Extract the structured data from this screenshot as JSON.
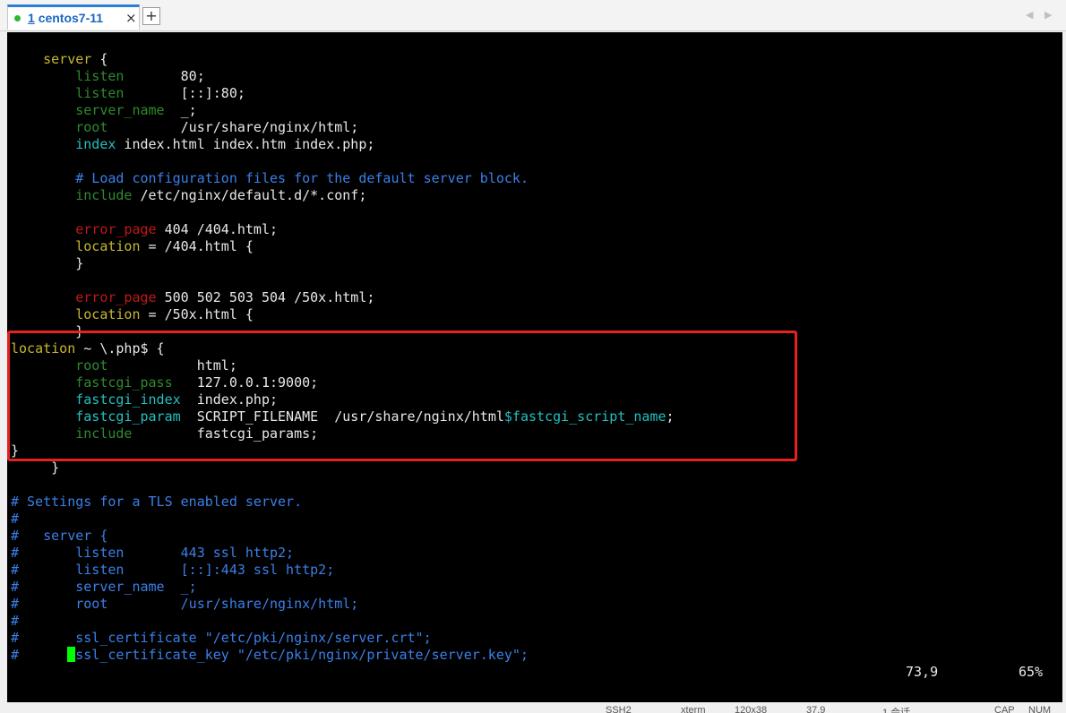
{
  "tabs": {
    "active": {
      "number": "1",
      "title": "centos7-11",
      "close": "×"
    },
    "add": "+",
    "prev": "◀",
    "next": "▶"
  },
  "terminal": {
    "lines": [
      [
        {
          "t": "    "
        },
        {
          "t": "server",
          "s": "ky"
        },
        {
          "t": " {"
        }
      ],
      [
        {
          "t": "        "
        },
        {
          "t": "listen",
          "s": "k"
        },
        {
          "t": "       80;"
        }
      ],
      [
        {
          "t": "        "
        },
        {
          "t": "listen",
          "s": "k"
        },
        {
          "t": "       [::]:80;"
        }
      ],
      [
        {
          "t": "        "
        },
        {
          "t": "server_name",
          "s": "k"
        },
        {
          "t": "  _;"
        }
      ],
      [
        {
          "t": "        "
        },
        {
          "t": "root",
          "s": "k"
        },
        {
          "t": "         /usr/share/nginx/html;"
        }
      ],
      [
        {
          "t": "        "
        },
        {
          "t": "index",
          "s": "kb"
        },
        {
          "t": " index.html index.htm index.php;"
        }
      ],
      [
        {
          "t": ""
        }
      ],
      [
        {
          "t": "        "
        },
        {
          "t": "# Load configuration files for the default server block.",
          "s": "c"
        }
      ],
      [
        {
          "t": "        "
        },
        {
          "t": "include",
          "s": "k"
        },
        {
          "t": " /etc/nginx/default.d/*.conf;"
        }
      ],
      [
        {
          "t": ""
        }
      ],
      [
        {
          "t": "        "
        },
        {
          "t": "error_page",
          "s": "kr"
        },
        {
          "t": " 404 /404.html;"
        }
      ],
      [
        {
          "t": "        "
        },
        {
          "t": "location",
          "s": "ky"
        },
        {
          "t": " = /404.html {"
        }
      ],
      [
        {
          "t": "        }"
        }
      ],
      [
        {
          "t": ""
        }
      ],
      [
        {
          "t": "        "
        },
        {
          "t": "error_page",
          "s": "kr"
        },
        {
          "t": " 500 502 503 504 /50x.html;"
        }
      ],
      [
        {
          "t": "        "
        },
        {
          "t": "location",
          "s": "ky"
        },
        {
          "t": " = /50x.html {"
        }
      ],
      [
        {
          "t": "        }"
        }
      ],
      [
        {
          "t": "location",
          "s": "ky"
        },
        {
          "t": " ~ \\.php$ {"
        }
      ],
      [
        {
          "t": "        "
        },
        {
          "t": "root",
          "s": "k"
        },
        {
          "t": "           html;"
        }
      ],
      [
        {
          "t": "        "
        },
        {
          "t": "fastcgi_pass",
          "s": "k"
        },
        {
          "t": "   127.0.0.1:9000;"
        }
      ],
      [
        {
          "t": "        "
        },
        {
          "t": "fastcgi_index",
          "s": "kb"
        },
        {
          "t": "  index.php;"
        }
      ],
      [
        {
          "t": "        "
        },
        {
          "t": "fastcgi_param",
          "s": "kb"
        },
        {
          "t": "  SCRIPT_FILENAME  /usr/share/nginx/html"
        },
        {
          "t": "$fastcgi_script_name",
          "s": "kb"
        },
        {
          "t": ";"
        }
      ],
      [
        {
          "t": "        "
        },
        {
          "t": "include",
          "s": "k"
        },
        {
          "t": "        fastcgi_params;"
        }
      ],
      [
        {
          "t": "}"
        }
      ],
      [
        {
          "t": "     }"
        }
      ],
      [
        {
          "t": ""
        }
      ],
      [
        {
          "t": "# Settings for a TLS enabled server.",
          "s": "c"
        }
      ],
      [
        {
          "t": "#",
          "s": "c"
        }
      ],
      [
        {
          "t": "#   ",
          "s": "c"
        },
        {
          "t": "server {",
          "s": "c"
        }
      ],
      [
        {
          "t": "#",
          "s": "c"
        },
        {
          "t": "       listen",
          "s": "c"
        },
        {
          "t": "       443 ssl http2;",
          "s": "c"
        }
      ],
      [
        {
          "t": "#",
          "s": "c"
        },
        {
          "t": "       listen",
          "s": "c"
        },
        {
          "t": "       [::]:443 ssl http2;",
          "s": "c"
        }
      ],
      [
        {
          "t": "#",
          "s": "c"
        },
        {
          "t": "       server_name",
          "s": "c"
        },
        {
          "t": "  _;",
          "s": "c"
        }
      ],
      [
        {
          "t": "#",
          "s": "c"
        },
        {
          "t": "       root",
          "s": "c"
        },
        {
          "t": "         /usr/share/nginx/html;",
          "s": "c"
        }
      ],
      [
        {
          "t": "#",
          "s": "c"
        }
      ],
      [
        {
          "t": "#",
          "s": "c"
        },
        {
          "t": "       ssl_certificate \"/etc/pki/nginx/server.crt\";",
          "s": "c"
        }
      ],
      [
        {
          "t": "#",
          "s": "c"
        },
        {
          "t": "      "
        },
        {
          "t": "",
          "s": "cursor"
        },
        {
          "t": "ssl_certificate_key \"/etc/pki/nginx/private/server.key\";",
          "s": "c"
        }
      ]
    ],
    "cursor_position": "73,9",
    "scroll_percent": "65%"
  },
  "statusbar": {
    "items": [
      "SSH2",
      "xterm",
      "120x38",
      "37,9",
      "1 会话",
      "CAP",
      "NUM"
    ]
  }
}
